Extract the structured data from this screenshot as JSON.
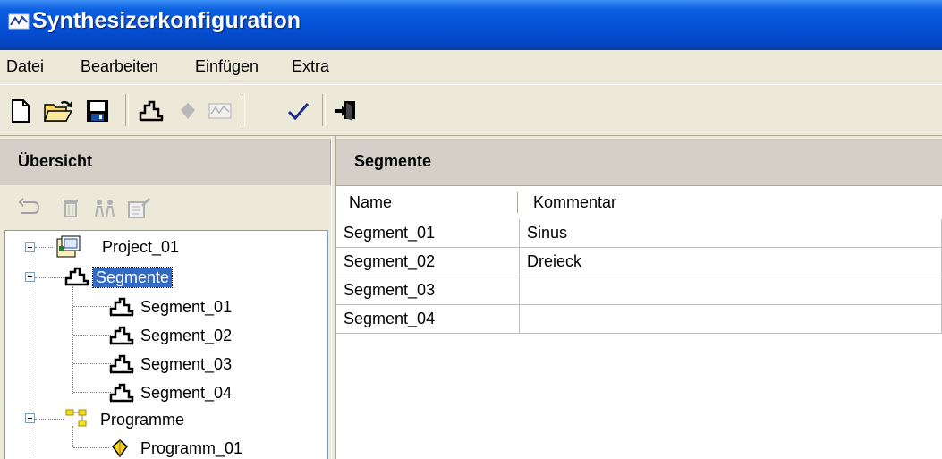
{
  "window": {
    "title": "Synthesizerkonfiguration",
    "icon": "chart-window-icon"
  },
  "menu": [
    "Datei",
    "Bearbeiten",
    "Einfügen",
    "Extra"
  ],
  "toolbar": {
    "icons": [
      "new-document-icon",
      "open-folder-icon",
      "save-icon",
      "segment-chart-icon",
      "diamond-icon",
      "waveform-icon",
      "check-icon",
      "exit-icon"
    ]
  },
  "left_panel": {
    "title": "Übersicht",
    "tools": [
      "undo-icon",
      "delete-icon",
      "people-icon",
      "properties-icon"
    ],
    "tree": {
      "root": "Project_01",
      "segments_label": "Segmente",
      "segments": [
        "Segment_01",
        "Segment_02",
        "Segment_03",
        "Segment_04"
      ],
      "programs_label": "Programme",
      "programs": [
        "Programm_01"
      ]
    }
  },
  "right_panel": {
    "title": "Segmente",
    "columns": [
      "Name",
      "Kommentar"
    ],
    "rows": [
      [
        "Segment_01",
        "Sinus"
      ],
      [
        "Segment_02",
        "Dreieck"
      ],
      [
        "Segment_03",
        ""
      ],
      [
        "Segment_04",
        ""
      ]
    ]
  },
  "colors": {
    "titlebar": "#0550d6",
    "selection": "#316ac5",
    "face": "#ece9d8"
  }
}
